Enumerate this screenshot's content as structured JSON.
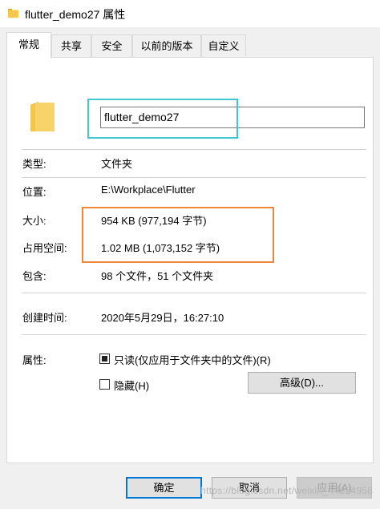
{
  "window": {
    "title": "flutter_demo27 属性"
  },
  "tabs": [
    "常规",
    "共享",
    "安全",
    "以前的版本",
    "自定义"
  ],
  "general": {
    "name_value": "flutter_demo27",
    "type_label": "类型:",
    "type_value": "文件夹",
    "location_label": "位置:",
    "location_value": "E:\\Workplace\\Flutter",
    "size_label": "大小:",
    "size_value": "954 KB (977,194 字节)",
    "size_on_disk_label": "占用空间:",
    "size_on_disk_value": "1.02 MB (1,073,152 字节)",
    "contains_label": "包含:",
    "contains_value": "98 个文件，51 个文件夹",
    "created_label": "创建时间:",
    "created_value": "2020年5月29日，16:27:10",
    "attributes_label": "属性:",
    "readonly_label": "只读(仅应用于文件夹中的文件)(R)",
    "hidden_label": "隐藏(H)",
    "advanced_label": "高级(D)..."
  },
  "footer": {
    "ok_label": "确定",
    "cancel_label": "取消",
    "apply_label": "应用(A)"
  },
  "watermark": "https://blog.csdn.net/weixin_44624958",
  "colors": {
    "folder": "#f5c64a",
    "highlight_cyan": "#40c8d0",
    "highlight_orange": "#f0883a",
    "primary_border": "#0078d7"
  },
  "icons": {
    "title": "folder-icon",
    "main": "folder-icon"
  },
  "state": {
    "readonly_checked": "indeterminate",
    "hidden_checked": false
  }
}
